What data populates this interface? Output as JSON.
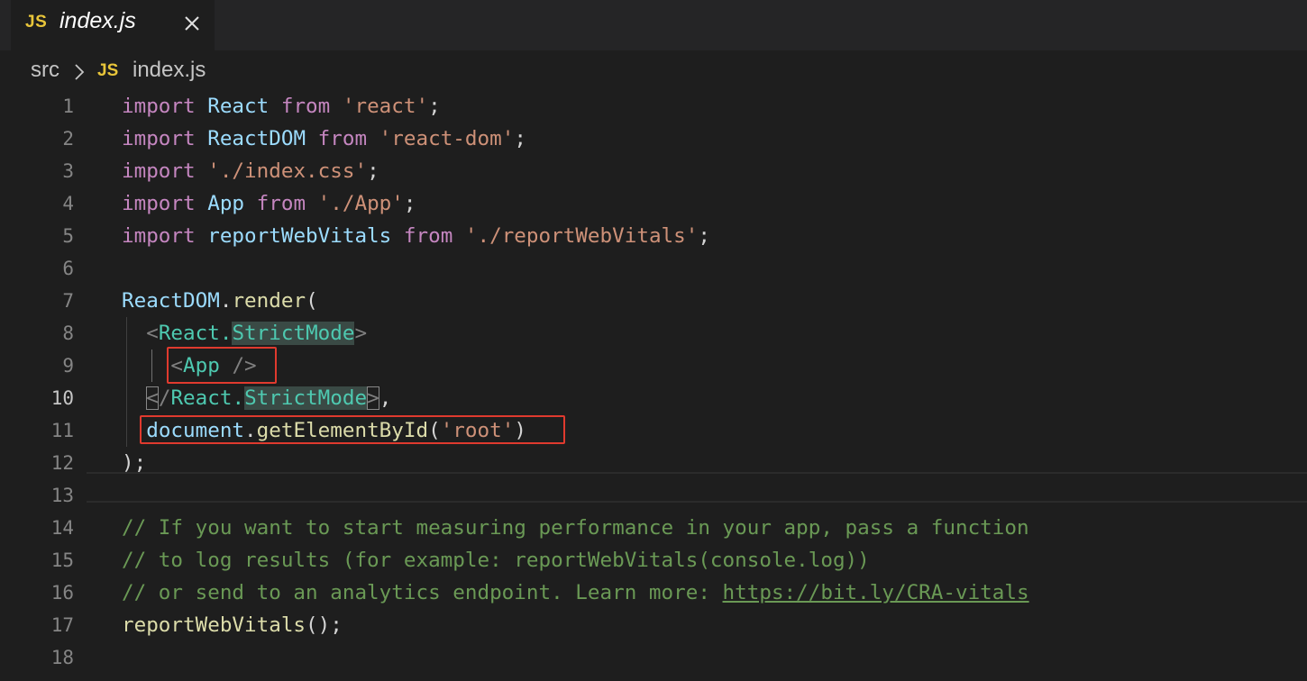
{
  "tab": {
    "badge": "JS",
    "filename": "index.js",
    "close_icon": "close-icon"
  },
  "breadcrumb": {
    "folder": "src",
    "badge": "JS",
    "file": "index.js"
  },
  "line_numbers": [
    "1",
    "2",
    "3",
    "4",
    "5",
    "6",
    "7",
    "8",
    "9",
    "10",
    "11",
    "12",
    "13",
    "14",
    "15",
    "16",
    "17",
    "18"
  ],
  "active_line": "10",
  "code": {
    "l1": {
      "kw1": "import",
      "id": " React",
      "kw2": " from",
      "str": " 'react'",
      "end": ";"
    },
    "l2": {
      "kw1": "import",
      "id": " ReactDOM",
      "kw2": " from",
      "str": " 'react-dom'",
      "end": ";"
    },
    "l3": {
      "kw1": "import",
      "str": " './index.css'",
      "end": ";"
    },
    "l4": {
      "kw1": "import",
      "id": " App",
      "kw2": " from",
      "str": " './App'",
      "end": ";"
    },
    "l5": {
      "kw1": "import",
      "id": " reportWebVitals",
      "kw2": " from",
      "str": " './reportWebVitals'",
      "end": ";"
    },
    "l7": {
      "obj": "ReactDOM",
      "dot": ".",
      "fn": "render",
      "paren": "("
    },
    "l8": {
      "lt": "<",
      "tag1": "React.",
      "tag2": "StrictMode",
      "gt": ">"
    },
    "l9": {
      "open": "<",
      "tag": "App",
      "close": " />"
    },
    "l10": {
      "lt": "<",
      "slash": "/",
      "tag1": "React.",
      "tag2": "StrictMode",
      "gt": ">",
      "comma": ","
    },
    "l11": {
      "obj": "document",
      "dot": ".",
      "fn": "getElementById",
      "p1": "(",
      "str": "'root'",
      "p2": ")"
    },
    "l12": {
      "text": ");"
    },
    "l14": {
      "text": "// If you want to start measuring performance in your app, pass a function"
    },
    "l15": {
      "text": "// to log results (for example: reportWebVitals(console.log))"
    },
    "l16": {
      "text": "// or send to an analytics endpoint. Learn more: ",
      "link": "https://bit.ly/CRA-vitals"
    },
    "l17": {
      "fn": "reportWebVitals",
      "end": "();"
    }
  },
  "colors": {
    "background": "#1e1e1e",
    "keyword": "#c586c0",
    "identifier": "#9cdcfe",
    "string": "#ce9178",
    "function": "#dcdcaa",
    "tag": "#4ec9b0",
    "comment": "#6a9955",
    "annotation_box": "#e03a2e",
    "js_badge": "#e8c53a"
  }
}
